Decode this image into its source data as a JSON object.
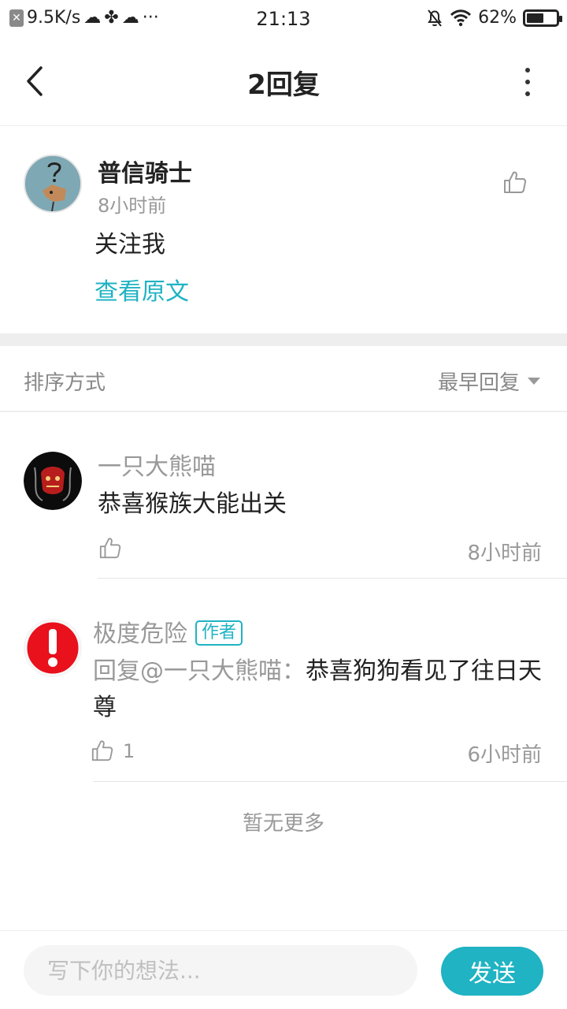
{
  "status_bar": {
    "net_speed": "9.5K/s",
    "time": "21:13",
    "battery": "62%",
    "battery_level": 0.62
  },
  "header": {
    "title": "2回复"
  },
  "post": {
    "author": "普信骑士",
    "time": "8小时前",
    "content": "关注我",
    "view_original": "查看原文"
  },
  "sort": {
    "label": "排序方式",
    "value": "最早回复"
  },
  "replies": [
    {
      "author": "一只大熊喵",
      "content": "恭喜猴族大能出关",
      "time": "8小时前",
      "likes": ""
    },
    {
      "author": "极度危险",
      "badge": "作者",
      "mention": "回复@一只大熊喵：",
      "content": "恭喜狗狗看见了往日天尊",
      "time": "6小时前",
      "likes": "1"
    }
  ],
  "no_more": "暂无更多",
  "composer": {
    "placeholder": "写下你的想法...",
    "send_label": "发送"
  },
  "colors": {
    "accent": "#1fb3c3",
    "muted": "#999999"
  }
}
